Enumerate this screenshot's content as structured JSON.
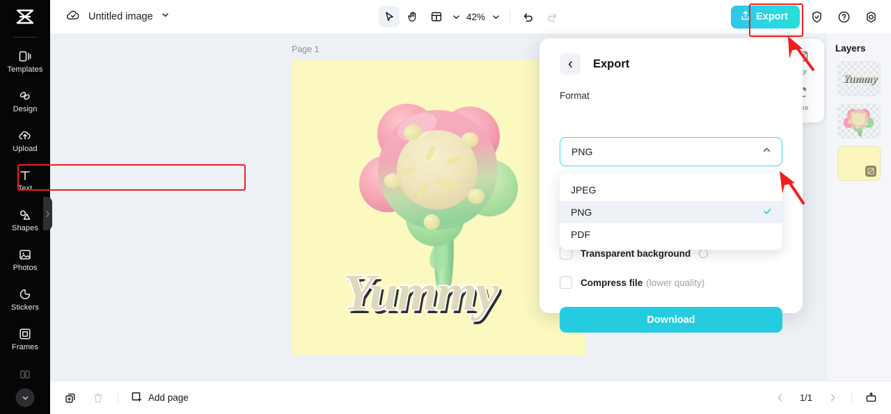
{
  "app": {
    "logo_icon": "capcut-logo-icon",
    "accent_cyan": "#25CCDF",
    "annotation_red": "#F31C1C",
    "canvas_yellow": "#FBF8C0",
    "workspace_bg": "#EDF1F5"
  },
  "sidebar": {
    "items": [
      {
        "label": "Templates",
        "icon": "templates-icon"
      },
      {
        "label": "Design",
        "icon": "design-icon"
      },
      {
        "label": "Upload",
        "icon": "upload-cloud-icon"
      },
      {
        "label": "Text",
        "icon": "text-icon"
      },
      {
        "label": "Shapes",
        "icon": "shapes-icon"
      },
      {
        "label": "Photos",
        "icon": "photos-icon"
      },
      {
        "label": "Stickers",
        "icon": "stickers-icon"
      },
      {
        "label": "Frames",
        "icon": "frames-icon"
      }
    ],
    "expand_icon": "chevron-down-icon",
    "collapse_handle_icon": "chevron-right-icon"
  },
  "topbar": {
    "cloud_icon": "cloud-saved-icon",
    "doc_title": "Untitled image",
    "doc_chevron_icon": "chevron-down-icon",
    "tools": [
      {
        "name": "select",
        "icon": "cursor-arrow-icon",
        "active": true
      },
      {
        "name": "hand",
        "icon": "hand-icon",
        "active": false
      },
      {
        "name": "layout",
        "icon": "layout-grid-icon",
        "active": false
      }
    ],
    "layout_chevron_icon": "chevron-down-icon",
    "zoom_value": "42%",
    "zoom_chevron_icon": "chevron-down-icon",
    "undo_icon": "undo-icon",
    "redo_icon": "redo-icon",
    "export_label": "Export",
    "export_icon": "upload-share-icon",
    "shield_icon": "shield-check-icon",
    "help_icon": "question-circle-icon",
    "settings_icon": "gear-icon"
  },
  "canvas": {
    "page_label": "Page 1",
    "artwork_name": "flower-lollipop-3d",
    "heading_text": "Yummy"
  },
  "quick_tools": {
    "items": [
      {
        "label": "kgr",
        "icon": "remove-background-icon"
      },
      {
        "label": "size",
        "icon": "resize-icon"
      }
    ]
  },
  "layers": {
    "title": "Layers",
    "items": [
      {
        "name": "text-layer",
        "preview_text": "Yummy"
      },
      {
        "name": "image-layer",
        "preview_text": ""
      },
      {
        "name": "background-layer",
        "preview_text": "",
        "badge_icon": "background-badge-icon"
      }
    ]
  },
  "export_panel": {
    "back_icon": "chevron-left-icon",
    "heading": "Export",
    "format_label": "Format",
    "format_value": "PNG",
    "format_chevron_icon": "chevron-up-icon",
    "options": [
      {
        "label": "JPEG",
        "selected": false
      },
      {
        "label": "PNG",
        "selected": true
      },
      {
        "label": "PDF",
        "selected": false
      }
    ],
    "selected_check_icon": "check-icon",
    "transparent_label": "Transparent background",
    "transparent_info_icon": "info-icon",
    "compress_label": "Compress file",
    "compress_sub": "(lower quality)",
    "download_label": "Download"
  },
  "bottom_bar": {
    "duplicate_icon": "duplicate-page-icon",
    "delete_icon": "trash-icon",
    "add_page_label": "Add page",
    "add_page_icon": "square-plus-icon",
    "prev_icon": "chevron-left-icon",
    "page_counter": "1/1",
    "next_icon": "chevron-right-icon",
    "present_icon": "present-icon"
  },
  "annotations": {
    "export_highlight": "red-rectangle-export",
    "png_highlight": "red-rectangle-png-option",
    "arrow_to_export": "red-arrow-export",
    "arrow_to_png": "red-arrow-png"
  }
}
